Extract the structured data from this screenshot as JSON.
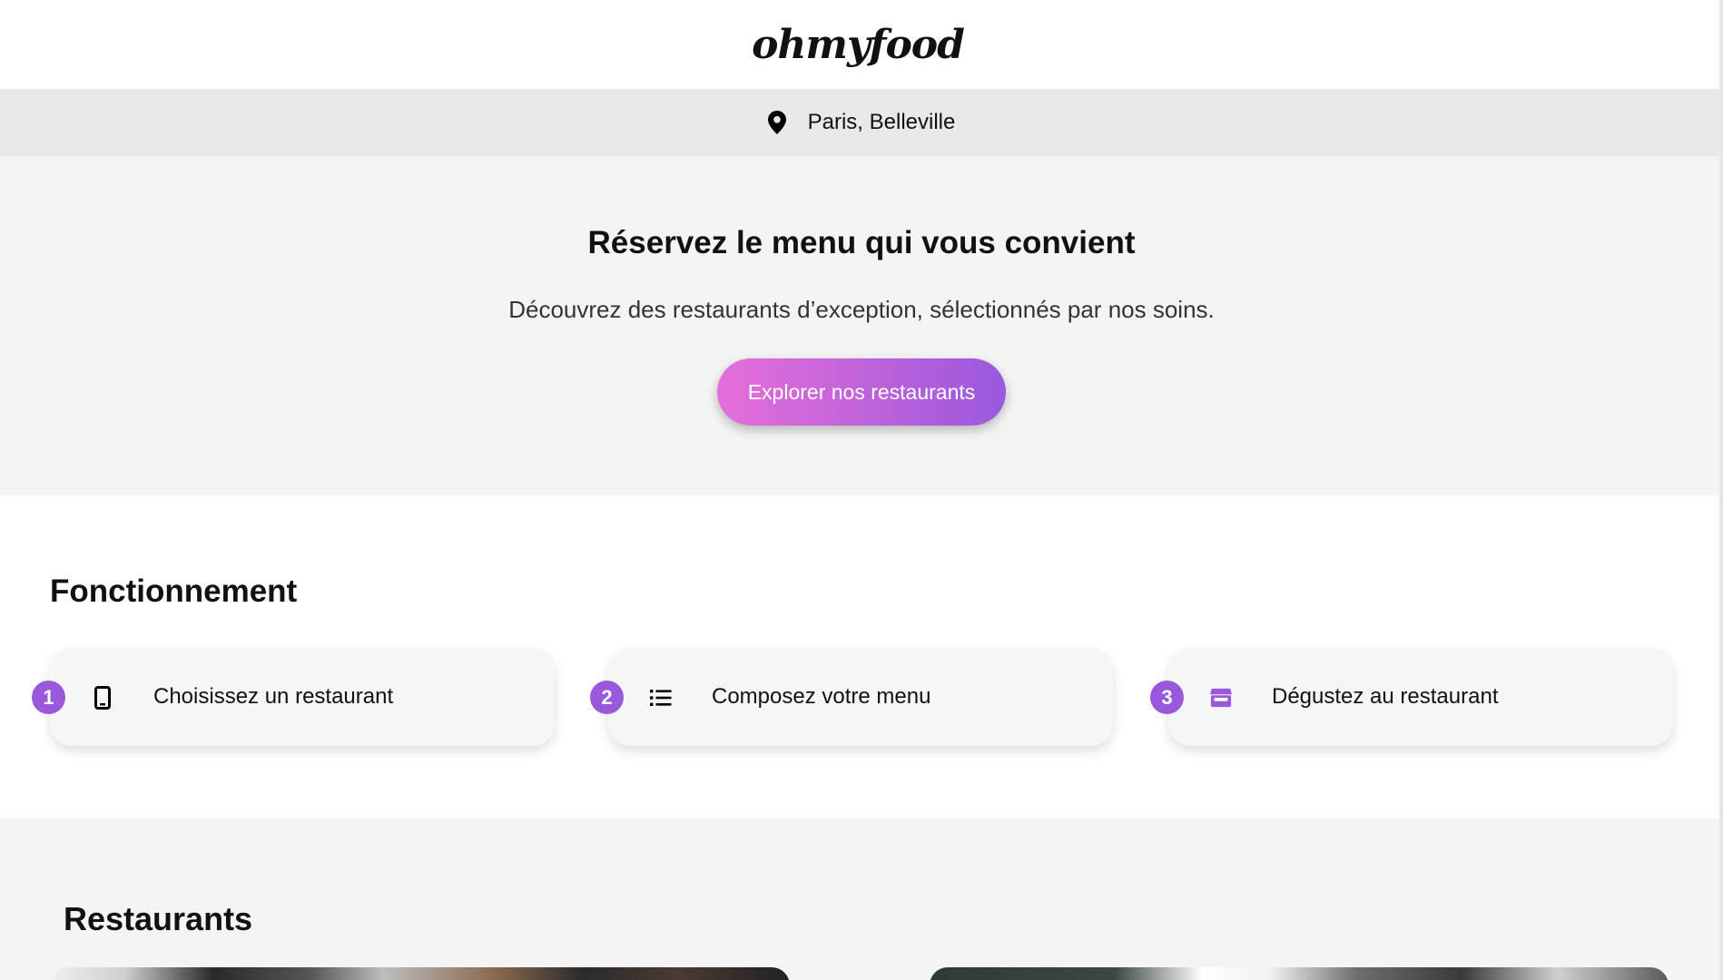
{
  "header": {
    "logo": "ohmyfood"
  },
  "location": {
    "icon": "map-pin-icon",
    "text": "Paris, Belleville"
  },
  "hero": {
    "title": "Réservez le menu qui vous convient",
    "subtitle": "Découvrez des restaurants d’exception, sélectionnés par nos soins.",
    "cta_label": "Explorer nos restaurants"
  },
  "how": {
    "title": "Fonctionnement",
    "steps": [
      {
        "number": "1",
        "icon": "smartphone-icon",
        "label": "Choisissez un restaurant"
      },
      {
        "number": "2",
        "icon": "list-icon",
        "label": "Composez votre menu"
      },
      {
        "number": "3",
        "icon": "store-icon",
        "label": "Dégustez au restaurant"
      }
    ]
  },
  "restaurants": {
    "title": "Restaurants"
  },
  "colors": {
    "accent_start": "#e66fd9",
    "accent_end": "#9a58dc",
    "badge": "#9a58dc"
  }
}
